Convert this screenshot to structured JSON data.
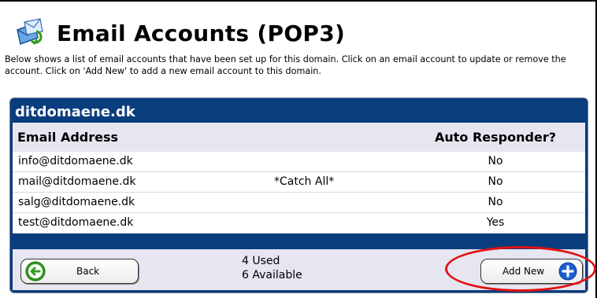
{
  "page": {
    "title": "Email Accounts (POP3)",
    "description": "Below shows a list of email accounts that have been set up for this domain. Click on an email account to update or remove the account. Click on 'Add New' to add a new email account to this domain."
  },
  "panel": {
    "domain": "ditdomaene.dk",
    "columns": {
      "email": "Email Address",
      "auto_responder": "Auto Responder?"
    },
    "rows": [
      {
        "email": "info@ditdomaene.dk",
        "flag": "",
        "auto_responder": "No"
      },
      {
        "email": "mail@ditdomaene.dk",
        "flag": "*Catch All*",
        "auto_responder": "No"
      },
      {
        "email": "salg@ditdomaene.dk",
        "flag": "",
        "auto_responder": "No"
      },
      {
        "email": "test@ditdomaene.dk",
        "flag": "",
        "auto_responder": "Yes"
      }
    ]
  },
  "footer": {
    "back_label": "Back",
    "used": "4 Used",
    "available": "6 Available",
    "add_label": "Add New"
  },
  "icons": {
    "header": "email-accounts-icon",
    "back": "back-arrow-icon",
    "add": "plus-circle-icon"
  },
  "colors": {
    "panel_header": "#0a3d7d",
    "row_alt": "#e6e6f1",
    "back_icon": "#2f9e1f",
    "add_icon": "#1a5fd1",
    "highlight": "#e01212"
  }
}
